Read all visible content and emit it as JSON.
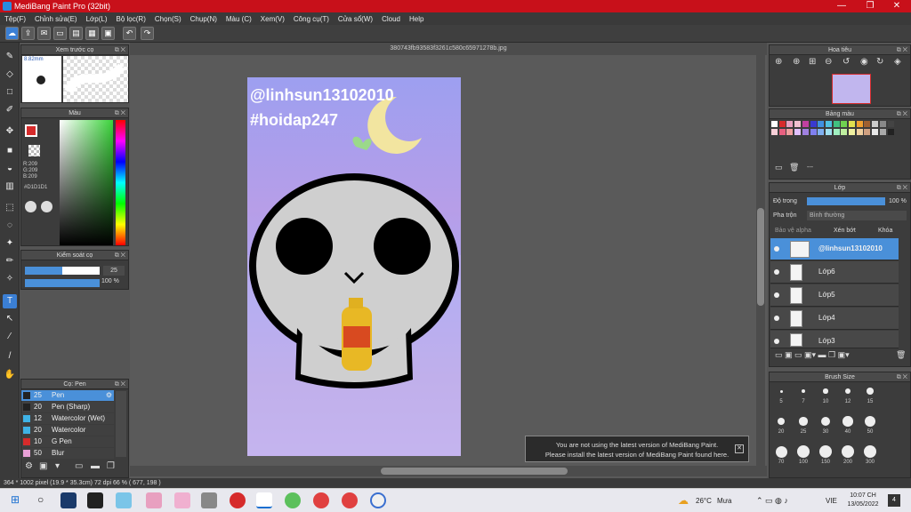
{
  "window": {
    "title": "MediBang Paint Pro (32bit)"
  },
  "menu": [
    "Tệp(F)",
    "Chỉnh sửa(E)",
    "Lớp(L)",
    "Bộ lọc(R)",
    "Chọn(S)",
    "Chụp(N)",
    "Màu (C)",
    "Xem(V)",
    "Công cụ(T)",
    "Cửa sổ(W)",
    "Cloud",
    "Help"
  ],
  "preview_panel": {
    "title": "Xem trước cọ",
    "size": "8.82mm"
  },
  "color_panel": {
    "title": "Màu",
    "r": "R:209",
    "g": "G:209",
    "b": "B:209",
    "hex": "#D1D1D1"
  },
  "brush_control": {
    "title": "Kiểm soát cọ",
    "size": "25",
    "opacity": "100 %"
  },
  "brush_panel": {
    "title": "Cọ: Pen",
    "items": [
      {
        "size": "25",
        "name": "Pen",
        "color": "#222222"
      },
      {
        "size": "20",
        "name": "Pen (Sharp)",
        "color": "#222222"
      },
      {
        "size": "12",
        "name": "Watercolor (Wet)",
        "color": "#3fb3e6"
      },
      {
        "size": "20",
        "name": "Watercolor",
        "color": "#3fb3e6"
      },
      {
        "size": "10",
        "name": "G Pen",
        "color": "#d62b2b"
      },
      {
        "size": "50",
        "name": "Blur",
        "color": "#e8a0d6"
      }
    ]
  },
  "document": {
    "filename": "380743fb93583f3261c580c65971278b.jpg",
    "text1": "@linhsun13102010",
    "text2": "#hoidap247"
  },
  "navigator": {
    "title": "Hoa tiêu"
  },
  "palette": {
    "title": "Bảng màu",
    "label": "---"
  },
  "layer_panel": {
    "title": "Lớp",
    "opacity_label": "Độ trong",
    "opacity_value": "100 %",
    "blend_label": "Pha trộn",
    "blend_value": "Bình thường",
    "protect_alpha": "Bảo vệ alpha",
    "clip": "Xén bớt",
    "lock": "Khóa",
    "layers": [
      "@linhsun13102010",
      "Lớp6",
      "Lớp5",
      "Lớp4",
      "Lớp3"
    ]
  },
  "brush_size": {
    "title": "Brush Size",
    "sizes": [
      "5",
      "7",
      "10",
      "12",
      "15",
      "20",
      "25",
      "30",
      "40",
      "50",
      "70",
      "100",
      "150",
      "200",
      "300"
    ]
  },
  "notice": {
    "line1": "You are not using the latest version of MediBang Paint.",
    "line2": "Please install the latest version of MediBang Paint found here."
  },
  "status": {
    "text": "364 * 1002 pixel   (19.9 * 35.3cm)   72 dpi   66 %   ( 677, 198 )"
  },
  "taskbar": {
    "weather": "26°C",
    "weather_text": "Mưa",
    "lang": "VIE",
    "time": "10:07 CH",
    "date": "13/05/2022",
    "notif": "4"
  },
  "colors": {
    "accent": "#4a90d9",
    "title": "#c8101a",
    "fg_swatch": "#d62b2b"
  }
}
